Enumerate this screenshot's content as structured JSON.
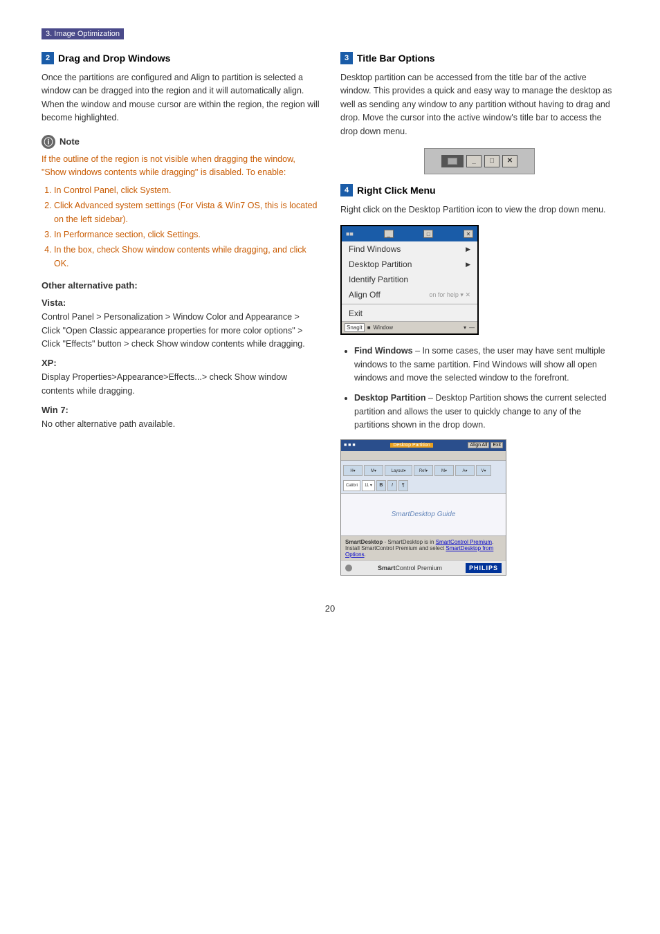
{
  "page": {
    "section_header": "3. Image Optimization",
    "page_number": "20"
  },
  "section2": {
    "num": "2",
    "title": "Drag and Drop Windows",
    "para1": "Once the partitions are configured and Align to partition is selected a window can be dragged into the region and it will automatically align. When the window and mouse cursor are within the region, the region will become highlighted.",
    "note": {
      "label": "Note",
      "orange_text": "If the outline of the region is not visible when dragging the window, \"Show windows contents while dragging\" is disabled.  To enable:",
      "steps": [
        "In Control Panel, click System.",
        "Click Advanced system settings  (For Vista & Win7 OS, this is located on the left sidebar).",
        "In Performance section, click Settings.",
        "In the box, check Show window contents while dragging, and click OK."
      ]
    },
    "other_path_title": "Other alternative path:",
    "vista_title": "Vista:",
    "vista_text": "Control Panel > Personalization > Window Color and Appearance > Click \"Open Classic appearance properties for more color options\" > Click \"Effects\" button > check Show window contents while dragging.",
    "xp_title": "XP:",
    "xp_text": "Display Properties>Appearance>Effects...> check Show window contents while dragging.",
    "win7_title": "Win 7:",
    "win7_text": "No other alternative path available."
  },
  "section3": {
    "num": "3",
    "title": "Title Bar Options",
    "para1": "Desktop partition can be accessed from the title bar of the active window.  This provides a quick and easy way to manage the desktop as well as sending any window to any partition without having to drag and drop.  Move the cursor into the active window's title bar to access the drop down menu."
  },
  "section4": {
    "num": "4",
    "title": "Right Click Menu",
    "para1": "Right click on the Desktop Partition icon to view the drop down menu.",
    "menu_items": [
      {
        "label": "Find Windows",
        "has_sub": true
      },
      {
        "label": "Desktop Partition",
        "has_sub": true
      },
      {
        "label": "Identify Partition",
        "has_sub": false
      },
      {
        "label": "Align Off",
        "has_sub": false
      },
      {
        "label": "Exit",
        "has_sub": false
      }
    ],
    "bullet_items": [
      {
        "title": "Find Windows",
        "text": "– In some cases, the user may have sent multiple windows to the same partition.  Find Windows will show all open windows and move the selected window to the forefront."
      },
      {
        "title": "Desktop Partition",
        "text": "– Desktop Partition shows the current selected partition and allows the user to quickly change to any of the partitions shown in the drop down."
      }
    ],
    "desktop_partition_label": "Desktop Partition",
    "align_all_label": "Align All",
    "exit_label": "Exit",
    "snagit_label": "Snagit",
    "window_label": "Window",
    "smartdesktop_guide": "SmartDesktop Guide",
    "smartdesktop_text": "SmartDesktop - SmartDesktop is in SmartControl Premium. Install SmartControl Premium and select SmartDesktop from Options.",
    "smartcontrol_premium": "SmartControl Premium",
    "philips_label": "PHILIPS"
  }
}
